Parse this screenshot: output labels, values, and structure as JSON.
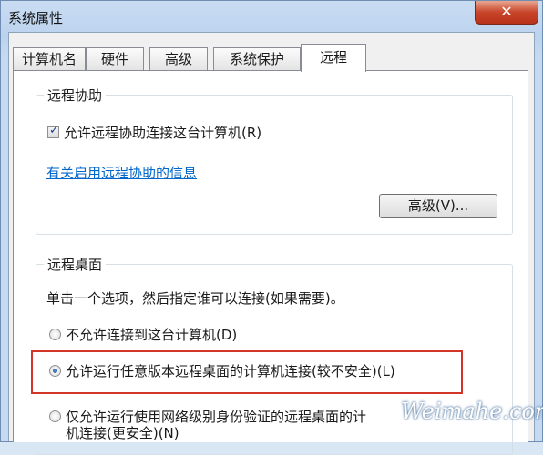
{
  "window": {
    "title": "系统属性",
    "close_glyph": "✕"
  },
  "tabs": [
    {
      "label": "计算机名",
      "active": false
    },
    {
      "label": "硬件",
      "active": false
    },
    {
      "label": "高级",
      "active": false
    },
    {
      "label": "系统保护",
      "active": false
    },
    {
      "label": "远程",
      "active": true
    }
  ],
  "remote_assistance": {
    "legend": "远程协助",
    "allow_checkbox_label": "允许远程协助连接这台计算机(R)",
    "allow_checked": true,
    "info_link": "有关启用远程协助的信息",
    "advanced_button": "高级(V)..."
  },
  "remote_desktop": {
    "legend": "远程桌面",
    "instruction": "单击一个选项，然后指定谁可以连接(如果需要)。",
    "options": [
      {
        "label": "不允许连接到这台计算机(D)",
        "selected": false
      },
      {
        "label": "允许运行任意版本远程桌面的计算机连接(较不安全)(L)",
        "selected": true
      },
      {
        "label": "仅允许运行使用网络级别身份验证的远程桌面的计",
        "label_line2": "机连接(更安全)(N)",
        "selected": false
      }
    ]
  },
  "watermark": "Weimahe.com",
  "colors": {
    "highlight": "#d2342a",
    "link": "#0066cc",
    "close": "#c8452a"
  }
}
